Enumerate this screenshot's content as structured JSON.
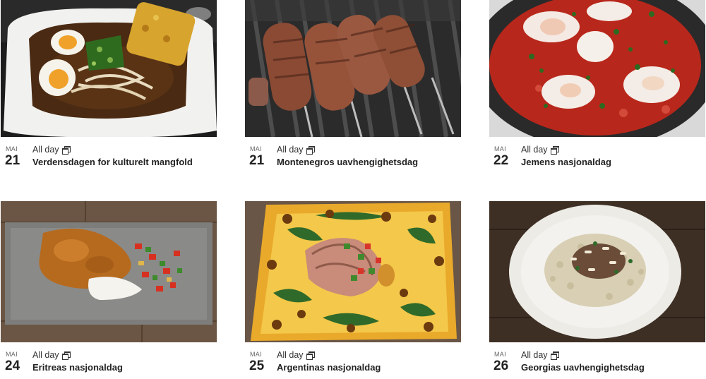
{
  "events": [
    {
      "month": "MAI",
      "day": "21",
      "all_day": "All day",
      "title": "Verdensdagen for kulturelt mangfold",
      "image": "ramen-bowl"
    },
    {
      "month": "MAI",
      "day": "21",
      "all_day": "All day",
      "title": "Montenegros uavhengighetsdag",
      "image": "grilled-kebab-skewers"
    },
    {
      "month": "MAI",
      "day": "22",
      "all_day": "All day",
      "title": "Jemens nasjonaldag",
      "image": "shakshuka-pan"
    },
    {
      "month": "MAI",
      "day": "24",
      "all_day": "All day",
      "title": "Eritreas nasjonaldag",
      "image": "stew-with-rice-plate"
    },
    {
      "month": "MAI",
      "day": "25",
      "all_day": "All day",
      "title": "Argentinas nasjonaldag",
      "image": "sliced-meat-on-yellow-plate"
    },
    {
      "month": "MAI",
      "day": "26",
      "all_day": "All day",
      "title": "Georgias uavhengighetsdag",
      "image": "pasta-with-mushrooms-plate"
    }
  ],
  "icons": {
    "external_window": "external-window-icon"
  },
  "colors": {
    "text": "#222222",
    "muted": "#666666"
  }
}
